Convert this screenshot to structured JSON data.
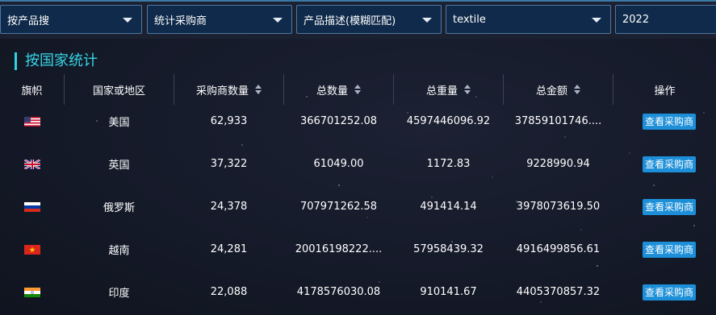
{
  "filters": [
    {
      "value": "按产品搜"
    },
    {
      "value": "统计采购商"
    },
    {
      "value": "产品描述(模糊匹配)"
    },
    {
      "value": "textile"
    },
    {
      "value": "2022"
    }
  ],
  "section_title": "按国家统计",
  "table": {
    "columns": [
      "旗帜",
      "国家或地区",
      "采购商数量",
      "总数量",
      "总重量",
      "总金额",
      "操作"
    ],
    "rows": [
      {
        "country": "美国",
        "buyers": "62,933",
        "qty": "366701252.08",
        "weight": "4597446096.92",
        "amount": "37859101746....",
        "action": "查看采购商",
        "flag": "flag-usa-icon"
      },
      {
        "country": "英国",
        "buyers": "37,322",
        "qty": "61049.00",
        "weight": "1172.83",
        "amount": "9228990.94",
        "action": "查看采购商",
        "flag": "flag-uk-icon"
      },
      {
        "country": "俄罗斯",
        "buyers": "24,378",
        "qty": "707971262.58",
        "weight": "491414.14",
        "amount": "3978073619.50",
        "action": "查看采购商",
        "flag": "flag-russia-icon"
      },
      {
        "country": "越南",
        "buyers": "24,281",
        "qty": "20016198222....",
        "weight": "57958439.32",
        "amount": "4916499856.61",
        "action": "查看采购商",
        "flag": "flag-vietnam-icon"
      },
      {
        "country": "印度",
        "buyers": "22,088",
        "qty": "4178576030.08",
        "weight": "910141.67",
        "amount": "4405370857.32",
        "action": "查看采购商",
        "flag": "flag-india-icon"
      }
    ]
  },
  "colors": {
    "accent": "#35d6e6",
    "button": "#1c8fd8",
    "background": "#151a29"
  }
}
